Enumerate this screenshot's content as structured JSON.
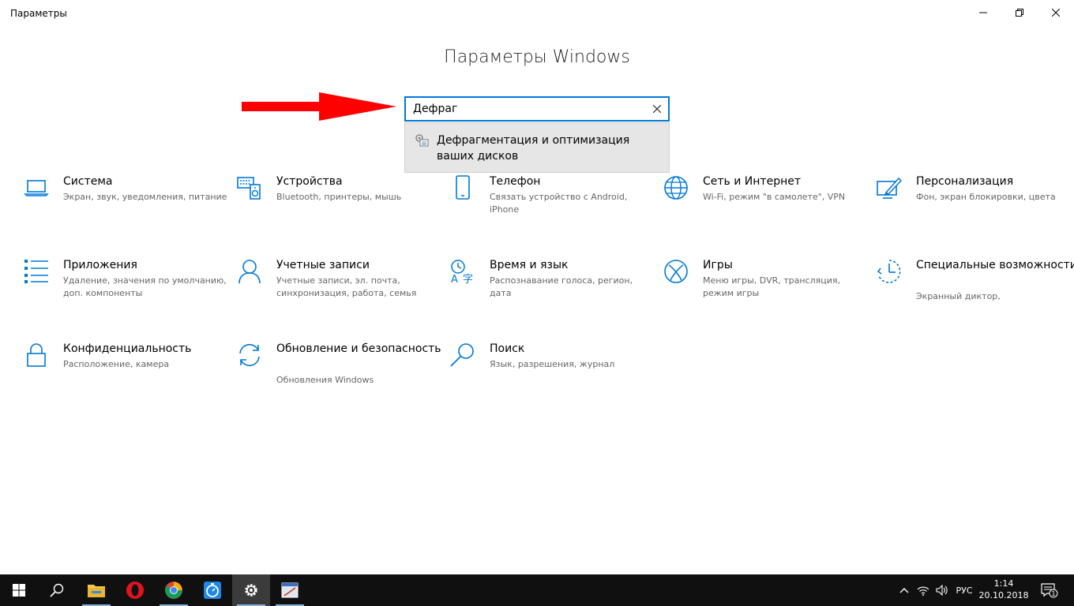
{
  "window": {
    "title": "Параметры",
    "controls": {
      "minimize": "minimize-icon",
      "maximize": "restore-icon",
      "close": "close-icon"
    }
  },
  "page_title": "Параметры Windows",
  "search": {
    "value": "Дефраг",
    "placeholder": "",
    "clear_icon": "clear-x-icon"
  },
  "suggestion": {
    "icon": "defrag-tool-icon",
    "label": "Дефрагментация и оптимизация ваших дисков"
  },
  "tiles": [
    {
      "icon": "laptop-icon",
      "name": "Система",
      "desc": "Экран, звук, уведомления, питание"
    },
    {
      "icon": "devices-icon",
      "name": "Устройства",
      "desc": "Bluetooth, принтеры, мышь"
    },
    {
      "icon": "phone-icon",
      "name": "Телефон",
      "desc": "Связать устройство с Android, iPhone"
    },
    {
      "icon": "globe-icon",
      "name": "Сеть и Интернет",
      "desc": "Wi-Fi, режим \"в самолете\", VPN"
    },
    {
      "icon": "personalization-icon",
      "name": "Персонализация",
      "desc": "Фон, экран блокировки, цвета"
    },
    {
      "icon": "apps-list-icon",
      "name": "Приложения",
      "desc": "Удаление, значения по умолчанию, доп. компоненты"
    },
    {
      "icon": "person-icon",
      "name": "Учетные записи",
      "desc": "Учетные записи, эл. почта, синхронизация, работа, семья"
    },
    {
      "icon": "time-language-icon",
      "name": "Время и язык",
      "desc": "Распознавание голоса, регион, дата"
    },
    {
      "icon": "xbox-icon",
      "name": "Игры",
      "desc": "Меню игры, DVR, трансляция, режим игры"
    },
    {
      "icon": "ease-of-access-icon",
      "name": "Специальные возможности",
      "desc": "Экранный диктор,"
    },
    {
      "icon": "lock-icon",
      "name": "Конфиденциальность",
      "desc": "Расположение, камера"
    },
    {
      "icon": "update-sync-icon",
      "name": "Обновление и безопасность",
      "desc": "Обновления Windows"
    },
    {
      "icon": "search-magnifier-icon",
      "name": "Поиск",
      "desc": "Язык, разрешения, журнал"
    }
  ],
  "taskbar": {
    "apps": [
      "windows-start-icon",
      "search-icon",
      "file-explorer-icon",
      "opera-icon",
      "chrome-icon",
      "stopwatch-icon",
      "settings-gear-icon",
      "app-window-icon"
    ],
    "tray": {
      "chevron": "chevron-up-icon",
      "network": "wifi-icon",
      "volume": "volume-icon",
      "language": "РУС",
      "time": "1:14",
      "date": "20.10.2018",
      "notifications_count": "1"
    }
  },
  "colors": {
    "accent": "#0078d7",
    "arrow": "#ff0000",
    "taskbar": "#101010"
  }
}
